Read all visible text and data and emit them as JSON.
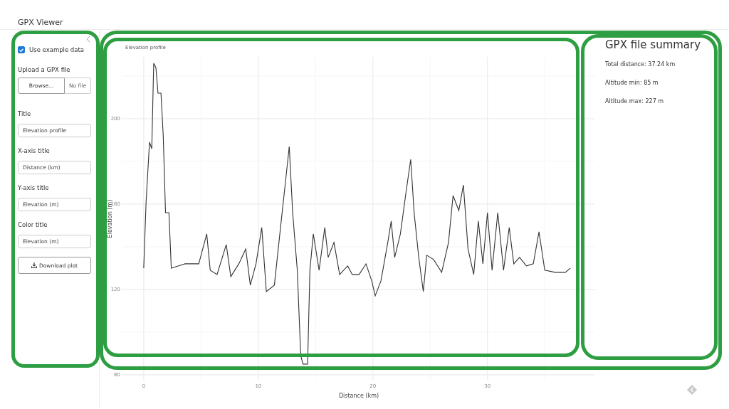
{
  "app_title": "GPX Viewer",
  "sidebar": {
    "controls": [
      {
        "kind": "checkbox",
        "label": "Use example data",
        "checked": true
      },
      {
        "kind": "file",
        "label": "Upload a GPX file",
        "button": "Browse...",
        "value": "No file"
      },
      {
        "kind": "text",
        "label": "Title",
        "value": "Elevation profile"
      },
      {
        "kind": "text",
        "label": "X-axis title",
        "value": "Distance (km)"
      },
      {
        "kind": "text",
        "label": "Y-axis title",
        "value": "Elevation (m)"
      },
      {
        "kind": "text",
        "label": "Color title",
        "value": "Elevation (m)"
      },
      {
        "kind": "button",
        "label": "Download plot"
      }
    ]
  },
  "plot": {
    "chart_data": {
      "type": "line",
      "title": "Elevation profile",
      "xlabel": "Distance (km)",
      "ylabel": "Elevation (m)",
      "x": [
        0,
        0.2,
        0.5,
        0.7,
        0.87,
        1.06,
        1.24,
        1.5,
        1.7,
        1.9,
        2.2,
        2.4,
        3.0,
        3.6,
        4.2,
        4.8,
        5.5,
        5.8,
        6.4,
        7.2,
        7.6,
        8.3,
        8.9,
        9.3,
        9.8,
        10.3,
        10.7,
        11.4,
        12.0,
        12.4,
        12.7,
        13.0,
        13.4,
        13.7,
        13.9,
        14.3,
        14.5,
        14.8,
        15.3,
        15.8,
        16.1,
        16.6,
        17.1,
        17.8,
        18.2,
        18.8,
        19.4,
        19.9,
        20.2,
        20.7,
        21.3,
        21.6,
        21.9,
        22.4,
        22.9,
        23.3,
        23.6,
        24.0,
        24.4,
        24.7,
        25.3,
        26.0,
        26.6,
        27.0,
        27.5,
        27.9,
        28.3,
        28.8,
        29.2,
        29.6,
        30.0,
        30.4,
        30.9,
        31.4,
        31.9,
        32.3,
        32.8,
        33.4,
        34.0,
        34.5,
        35.0,
        35.9,
        36.8,
        37.24
      ],
      "series": [
        {
          "color": "#333333",
          "values": [
            130,
            161,
            189,
            186,
            226,
            224,
            212,
            212,
            192,
            156,
            156,
            130,
            131,
            132,
            132,
            132,
            146,
            129,
            127,
            141,
            126,
            132,
            139,
            122,
            132,
            149,
            119,
            122,
            152,
            172,
            187,
            156,
            129,
            89,
            85,
            85,
            129,
            146,
            129,
            149,
            135,
            142,
            127,
            131,
            127,
            127,
            132,
            124,
            117,
            124,
            142,
            152,
            135,
            146,
            166,
            181,
            156,
            135,
            119,
            136,
            134,
            128,
            142,
            164,
            157,
            169,
            139,
            127,
            152,
            132,
            156,
            129,
            156,
            129,
            149,
            132,
            135,
            131,
            132,
            147,
            129,
            128,
            128,
            130
          ]
        }
      ],
      "xlim": [
        -1.86,
        39.4
      ],
      "ylim": [
        77.3,
        229
      ],
      "xticks": [
        0,
        10,
        20,
        30
      ],
      "yticks": [
        80,
        120,
        160,
        200
      ],
      "grid": true
    }
  },
  "summary": {
    "title": "GPX file summary",
    "lines": [
      "Total distance: 37.24 km",
      "Altitude min: 85 m",
      "Altitude max: 227 m"
    ]
  },
  "annotations": [
    {
      "kind": "outline"
    },
    {
      "kind": "outline"
    },
    {
      "kind": "outline"
    },
    {
      "kind": "outline"
    }
  ]
}
